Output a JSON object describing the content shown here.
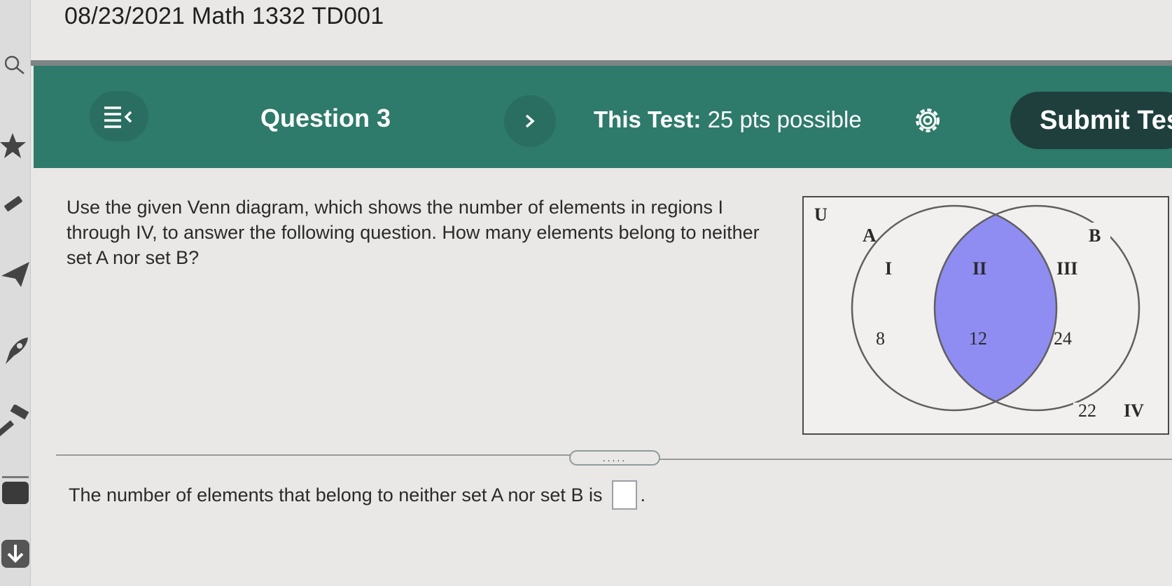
{
  "window": {
    "title": "08/23/2021 Math 1332 TD001"
  },
  "toolbar": {
    "question_label": "Question 3",
    "test_label": "This Test:",
    "test_points": "25 pts possible",
    "submit_label": "Submit Tes"
  },
  "question": {
    "text": "Use the given Venn diagram, which shows the number of elements in regions I through IV, to answer the following question. How many elements belong to neither set A nor set B?"
  },
  "venn": {
    "universe_label": "U",
    "set_a_label": "A",
    "set_b_label": "B",
    "regions": [
      {
        "name": "I",
        "count": "8"
      },
      {
        "name": "II",
        "count": "12"
      },
      {
        "name": "III",
        "count": "24"
      },
      {
        "name": "IV",
        "count": "22"
      }
    ],
    "highlight_color": "#8f8cf2"
  },
  "answer": {
    "prompt": "The number of elements that belong to neither set A nor set B is",
    "value": "",
    "suffix": "."
  },
  "divider": {
    "handle_glyph": "....."
  },
  "colors": {
    "toolbar": "#2e7a6b",
    "submit": "#1f3f3c"
  }
}
